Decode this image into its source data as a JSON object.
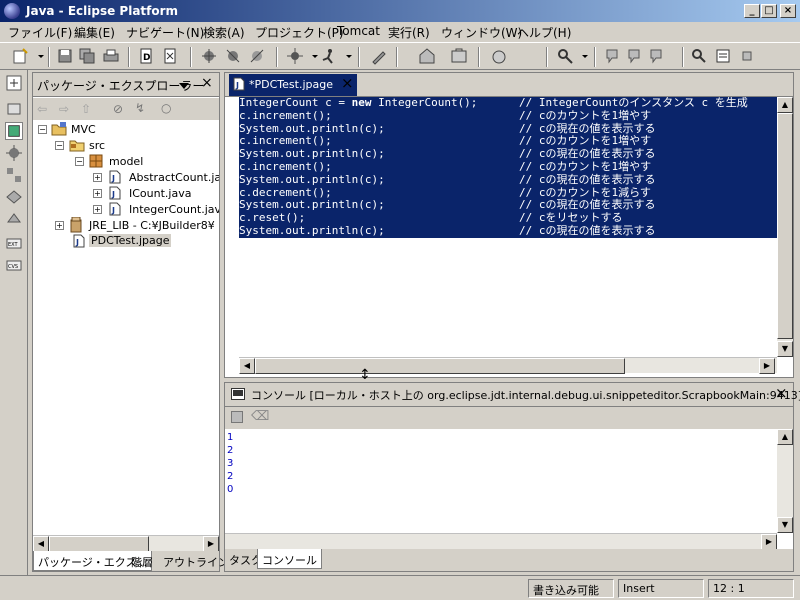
{
  "window": {
    "title": "Java - Eclipse Platform"
  },
  "menu": [
    "ファイル(F)",
    "編集(E)",
    "ナビゲート(N)",
    "検索(A)",
    "プロジェクト(P)",
    "Tomcat",
    "実行(R)",
    "ウィンドウ(W)",
    "ヘルプ(H)"
  ],
  "package_explorer": {
    "title": "パッケージ・エクスプローラー",
    "tree": [
      {
        "label": "MVC"
      },
      {
        "label": "src"
      },
      {
        "label": "model"
      },
      {
        "label": "AbstractCount.java"
      },
      {
        "label": "ICount.java"
      },
      {
        "label": "IntegerCount.java"
      },
      {
        "label": "JRE_LIB - C:¥JBuilder8¥"
      },
      {
        "label": "PDCTest.jpage"
      }
    ],
    "bottom_tabs": [
      "パッケージ・エクス...",
      "階層",
      "アウトライン"
    ]
  },
  "editor": {
    "tab_label": "*PDCTest.jpage",
    "lines": [
      {
        "code": "IntegerCount c = ",
        "kw": "new",
        "rest": " IntegerCount();",
        "comment": "// IntegerCountのインスタンス c を生成"
      },
      {
        "code": "c.increment();",
        "comment": "// cのカウントを1増やす"
      },
      {
        "code": "System.out.println(c);",
        "comment": "// cの現在の値を表示する"
      },
      {
        "code": "c.increment();",
        "comment": "// cのカウントを1増やす"
      },
      {
        "code": "System.out.println(c);",
        "comment": "// cの現在の値を表示する"
      },
      {
        "code": "c.increment();",
        "comment": "// cのカウントを1増やす"
      },
      {
        "code": "System.out.println(c);",
        "comment": "// cの現在の値を表示する"
      },
      {
        "code": "c.decrement();",
        "comment": "// cのカウントを1減らす"
      },
      {
        "code": "System.out.println(c);",
        "comment": "// cの現在の値を表示する"
      },
      {
        "code": "c.reset();",
        "comment": "// cをリセットする"
      },
      {
        "code": "System.out.println(c);",
        "comment": "// cの現在の値を表示する"
      }
    ]
  },
  "console": {
    "title": "コンソール [ローカル・ホスト上の org.eclipse.jdt.internal.debug.ui.snippeteditor.ScrapbookMain:9413]",
    "output": [
      "1",
      "2",
      "3",
      "2",
      "0"
    ],
    "bottom_tabs": [
      "タスク",
      "コンソール"
    ]
  },
  "status": {
    "writable": "書き込み可能",
    "insert_mode": "Insert",
    "position": "12 : 1"
  },
  "colors": {
    "selection_bg": "#0a246a",
    "title_active": "#0a246a",
    "console_text": "#0000c0"
  }
}
